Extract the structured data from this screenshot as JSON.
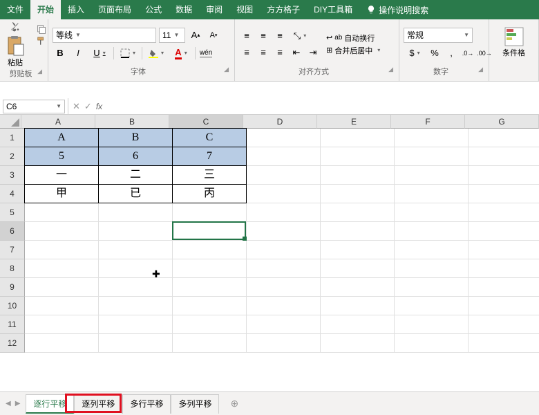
{
  "menubar": {
    "tabs": [
      "文件",
      "开始",
      "插入",
      "页面布局",
      "公式",
      "数据",
      "审阅",
      "视图",
      "方方格子",
      "DIY工具箱"
    ],
    "active_index": 1,
    "search_label": "操作说明搜索"
  },
  "ribbon": {
    "clipboard": {
      "label": "剪贴板",
      "paste": "粘贴"
    },
    "font": {
      "label": "字体",
      "name": "等线",
      "size": "11",
      "bold": "B",
      "italic": "I",
      "underline": "U"
    },
    "alignment": {
      "label": "对齐方式",
      "wrap": "自动换行",
      "merge": "合并后居中"
    },
    "number": {
      "label": "数字",
      "format": "常规"
    },
    "styles": {
      "condfmt": "条件格"
    }
  },
  "formula_bar": {
    "name_box": "C6",
    "fx": "fx",
    "value": ""
  },
  "grid": {
    "columns": [
      "A",
      "B",
      "C",
      "D",
      "E",
      "F",
      "G"
    ],
    "selected_col_index": 2,
    "row_count": 12,
    "selected_row_index": 5,
    "data": [
      [
        "A",
        "B",
        "C"
      ],
      [
        "5",
        "6",
        "7"
      ],
      [
        "一",
        "二",
        "三"
      ],
      [
        "甲",
        "已",
        "丙"
      ]
    ],
    "highlight_rows": [
      0,
      1
    ],
    "active_cell": {
      "row": 5,
      "col": 2
    }
  },
  "sheet_tabs": {
    "tabs": [
      "逐行平移",
      "逐列平移",
      "多行平移",
      "多列平移"
    ],
    "active_index": 0
  }
}
